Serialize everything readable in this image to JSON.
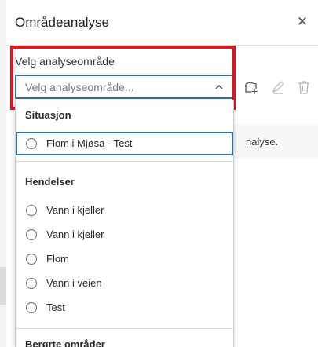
{
  "panel": {
    "title": "Områdeanalyse",
    "close_icon": "close-icon"
  },
  "field": {
    "label": "Velg analyseområde",
    "placeholder": "Velg analyseområde...",
    "chevron_icon": "chevron-up-icon"
  },
  "toolbar": {
    "icons": [
      "add-area-icon",
      "edit-pen-icon",
      "trash-icon"
    ]
  },
  "info": {
    "text": "nalyse."
  },
  "dropdown": {
    "groups": [
      {
        "title": "Situasjon",
        "items": [
          "Flom i Mjøsa - Test"
        ]
      },
      {
        "title": "Hendelser",
        "items": [
          "Vann i kjeller",
          "Vann i kjeller",
          "Flom",
          "Vann i veien",
          "Test"
        ]
      },
      {
        "title": "Berørte områder",
        "items": []
      }
    ]
  },
  "colors": {
    "accent": "#2f6f9f",
    "highlight": "#e1151f"
  }
}
